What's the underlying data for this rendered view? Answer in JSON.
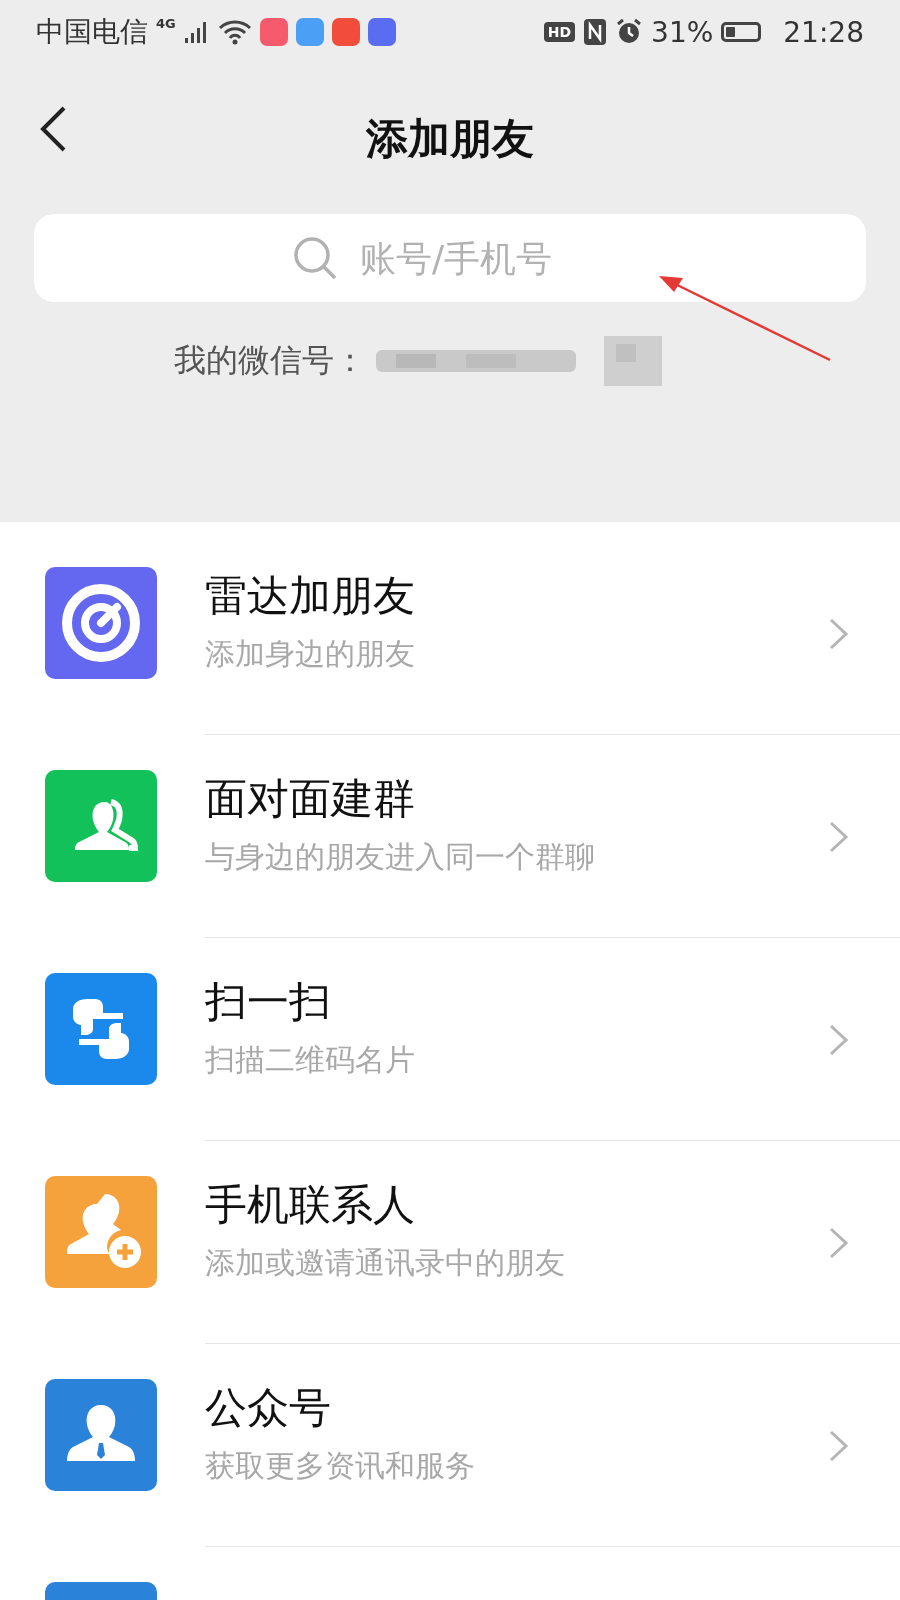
{
  "status_bar": {
    "carrier": "中国电信",
    "network": "4G",
    "hd": "HD",
    "battery_percent": "31%",
    "time": "21:28"
  },
  "header": {
    "title": "添加朋友"
  },
  "search": {
    "placeholder": "账号/手机号"
  },
  "my_id": {
    "label": "我的微信号："
  },
  "items": [
    {
      "title": "雷达加朋友",
      "subtitle": "添加身边的朋友",
      "color": "#6467ef"
    },
    {
      "title": "面对面建群",
      "subtitle": "与身边的朋友进入同一个群聊",
      "color": "#13c15a"
    },
    {
      "title": "扫一扫",
      "subtitle": "扫描二维码名片",
      "color": "#1b88ec"
    },
    {
      "title": "手机联系人",
      "subtitle": "添加或邀请通讯录中的朋友",
      "color": "#f6a23c"
    },
    {
      "title": "公众号",
      "subtitle": "获取更多资讯和服务",
      "color": "#2b82d9"
    },
    {
      "color": "#2b82d9"
    }
  ]
}
